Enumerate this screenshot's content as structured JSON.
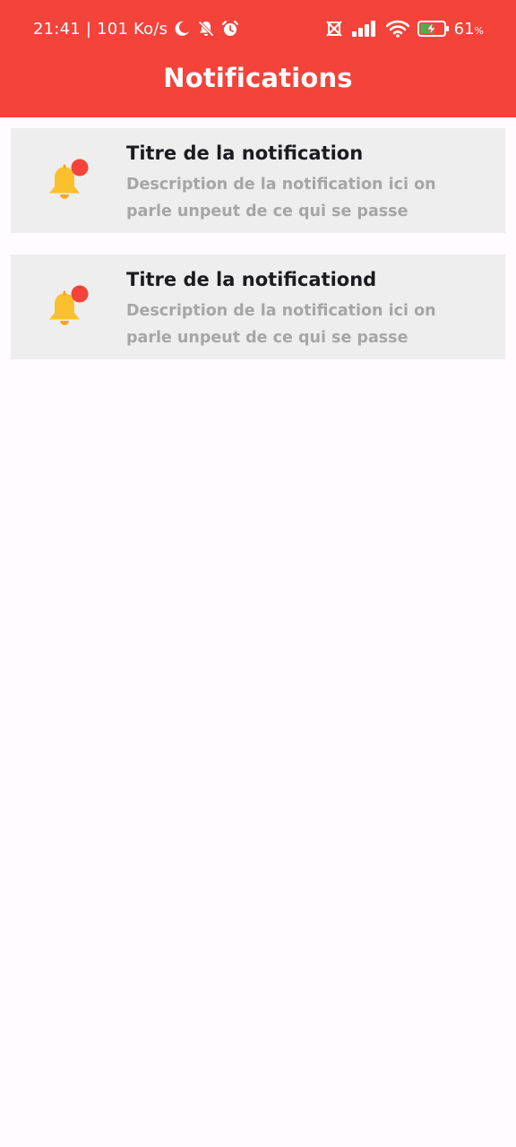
{
  "status_bar": {
    "time": "21:41",
    "separator": "|",
    "network_speed": "101 Ko/s",
    "left_icons": [
      "moon-icon",
      "bell-off-icon",
      "alarm-icon"
    ],
    "right_icons": [
      "no-sim-icon",
      "signal-icon",
      "wifi-icon",
      "battery-charging-icon"
    ],
    "battery_level": "61",
    "battery_unit": "%"
  },
  "header": {
    "title": "Notifications",
    "background_color": "#f4433a"
  },
  "notifications": [
    {
      "icon": "notification-bell-icon",
      "title": "Titre de la notification",
      "description": "Description de la notification ici on parle unpeut de ce qui se passe"
    },
    {
      "icon": "notification-bell-icon",
      "title": "Titre de la notificationd",
      "description": "Description de la notification ici on parle unpeut de ce qui se passe"
    }
  ],
  "colors": {
    "card_background": "#eeeeee",
    "bell": "#fbc02d",
    "badge": "#f4433a",
    "description": "#a6a6a6"
  }
}
